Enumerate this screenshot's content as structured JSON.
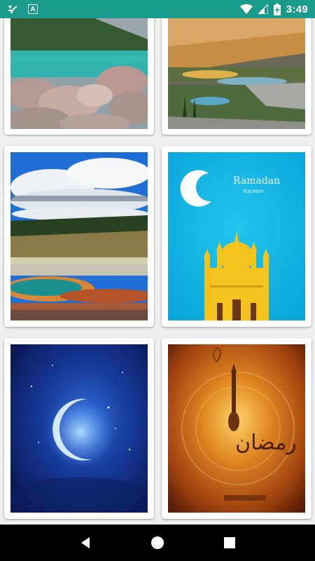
{
  "status_bar": {
    "time": "3:49",
    "battery_level": "charging",
    "background_color": "#1a9a8c",
    "icons": [
      "checklist-icon",
      "a-badge-icon",
      "wifi-icon",
      "cell-signal-icon",
      "battery-charging-icon"
    ],
    "a_badge_text": "A"
  },
  "wallpapers": [
    {
      "name": "Lake rocks",
      "alt": "lake-with-rocks"
    },
    {
      "name": "Mountain valley",
      "alt": "mountain-valley-lake"
    },
    {
      "name": "Hot spring",
      "alt": "colorful-hot-spring"
    },
    {
      "name": "Ramadan mosque",
      "alt": "ramadan-kareem-mosque",
      "caption_line1": "Ramadan",
      "caption_line2": "Kareem"
    },
    {
      "name": "Blue crescent",
      "alt": "blue-crescent-moon"
    },
    {
      "name": "Ramadan calligraphy",
      "alt": "ramadan-calligraphy-lantern",
      "calligraphy": "رمضان"
    }
  ],
  "navigation": {
    "back": "back-button",
    "home": "home-button",
    "recents": "recents-button"
  }
}
